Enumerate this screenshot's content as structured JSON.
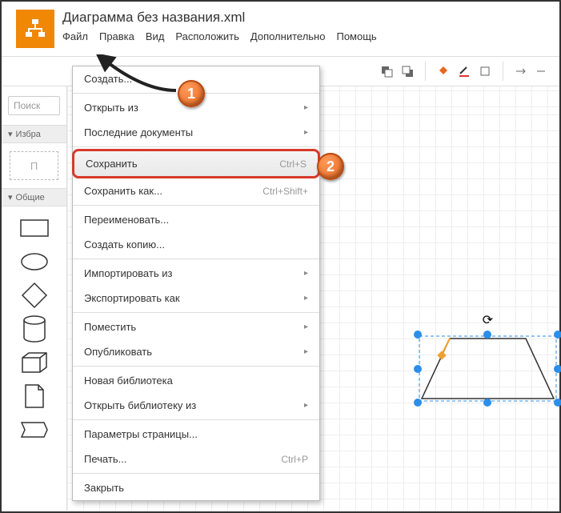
{
  "title": "Диаграмма без названия.xml",
  "menubar": [
    "Файл",
    "Правка",
    "Вид",
    "Расположить",
    "Дополнительно",
    "Помощь"
  ],
  "search_placeholder": "Поиск",
  "sections": {
    "fav": "Избра",
    "shared": "Общие"
  },
  "scratch_label": "П",
  "menu": {
    "create": "Создать...",
    "open_from": "Открыть из",
    "recent": "Последние документы",
    "save": "Сохранить",
    "save_sc": "Ctrl+S",
    "save_as": "Сохранить как...",
    "save_as_sc": "Ctrl+Shift+",
    "rename": "Переименовать...",
    "copy": "Создать копию...",
    "import": "Импортировать из",
    "export": "Экспортировать как",
    "embed": "Поместить",
    "publish": "Опубликовать",
    "newlib": "Новая библиотека",
    "openlib": "Открыть библиотеку из",
    "pagesetup": "Параметры страницы...",
    "print": "Печать...",
    "print_sc": "Ctrl+P",
    "close": "Закрыть"
  },
  "annotations": {
    "step1": "1",
    "step2": "2"
  }
}
